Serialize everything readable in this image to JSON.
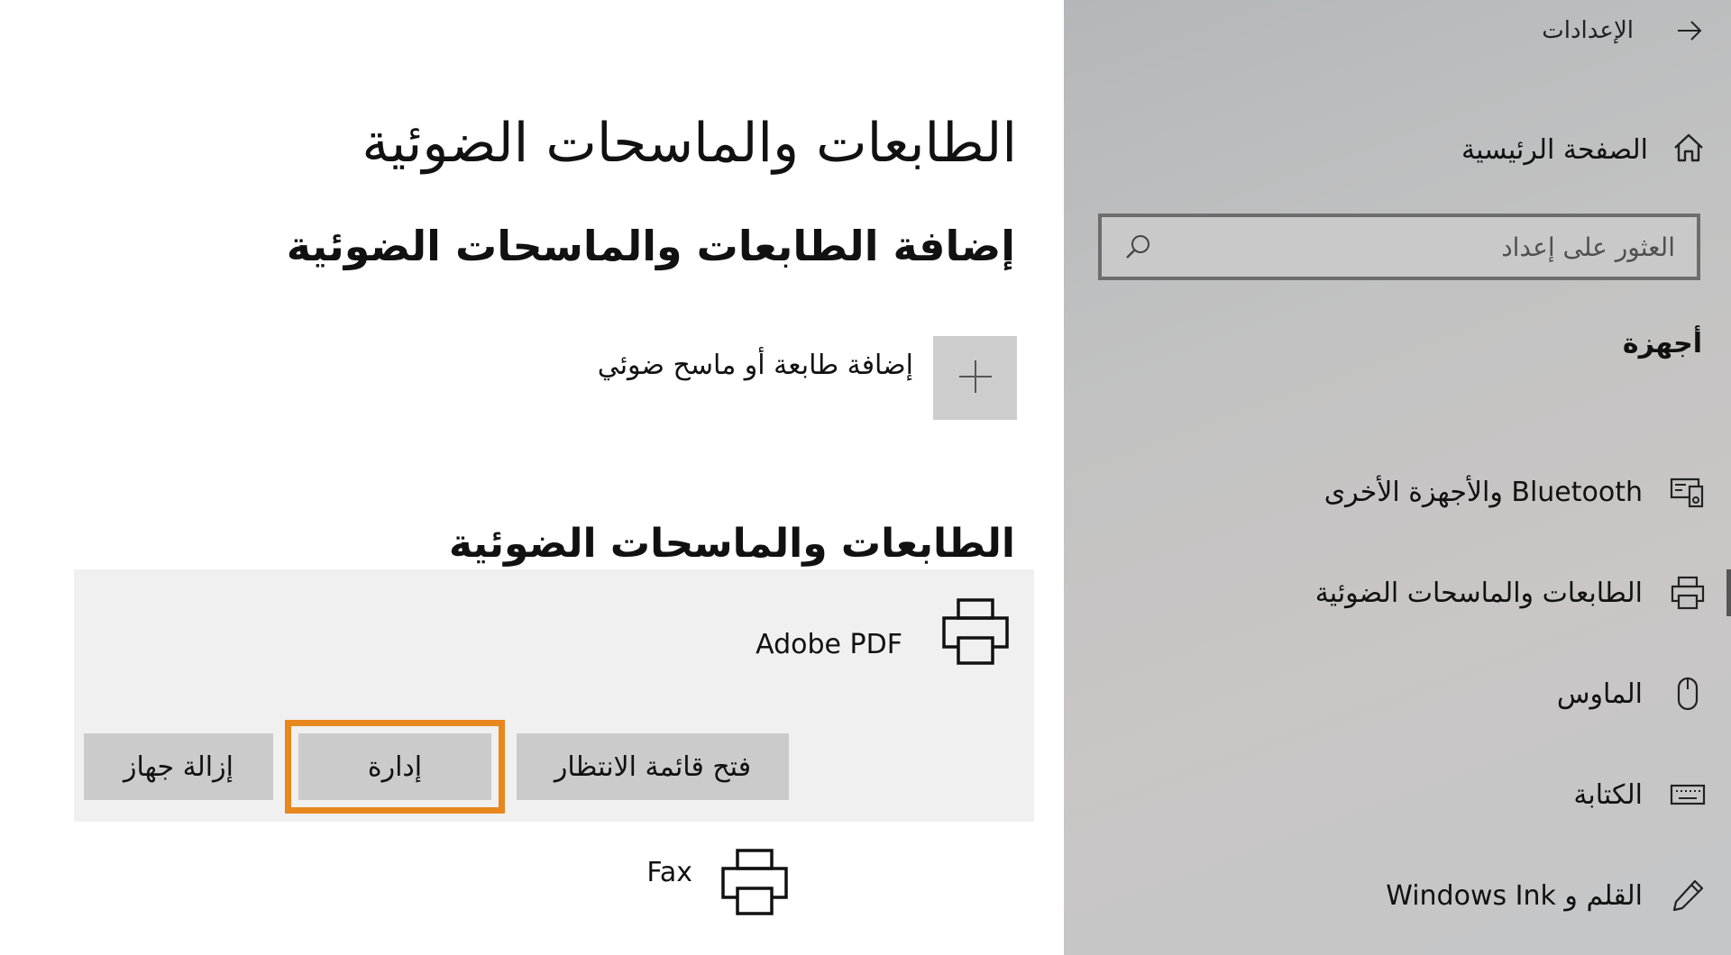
{
  "app": {
    "title": "الإعدادات",
    "back_icon": "arrow-right-icon"
  },
  "nav": {
    "home_label": "الصفحة الرئيسية",
    "search_placeholder": "العثور على إعداد",
    "section_header": "أجهزة",
    "items": [
      {
        "label": "Bluetooth والأجهزة الأخرى",
        "icon": "devices-icon",
        "selected": false
      },
      {
        "label": "الطابعات والماسحات الضوئية",
        "icon": "printer-icon",
        "selected": true
      },
      {
        "label": "الماوس",
        "icon": "mouse-icon",
        "selected": false
      },
      {
        "label": "الكتابة",
        "icon": "keyboard-icon",
        "selected": false
      },
      {
        "label": "القلم و Windows Ink",
        "icon": "pen-icon",
        "selected": false
      }
    ]
  },
  "main": {
    "page_title": "الطابعات والماسحات الضوئية",
    "add_section_title": "إضافة الطابعات والماسحات الضوئية",
    "add_device_label": "إضافة طابعة أو ماسح ضوئي",
    "list_title": "الطابعات والماسحات الضوئية",
    "devices": [
      {
        "name": "Adobe PDF",
        "actions": {
          "open_queue": "فتح قائمة الانتظار",
          "manage": "إدارة",
          "remove": "إزالة جهاز"
        }
      },
      {
        "name": "Fax"
      }
    ]
  },
  "colors": {
    "highlight": "#e8871e",
    "nav_background": "#c2c2c2",
    "card_background": "#f0f0f0",
    "button_background": "#cbcbcb"
  }
}
